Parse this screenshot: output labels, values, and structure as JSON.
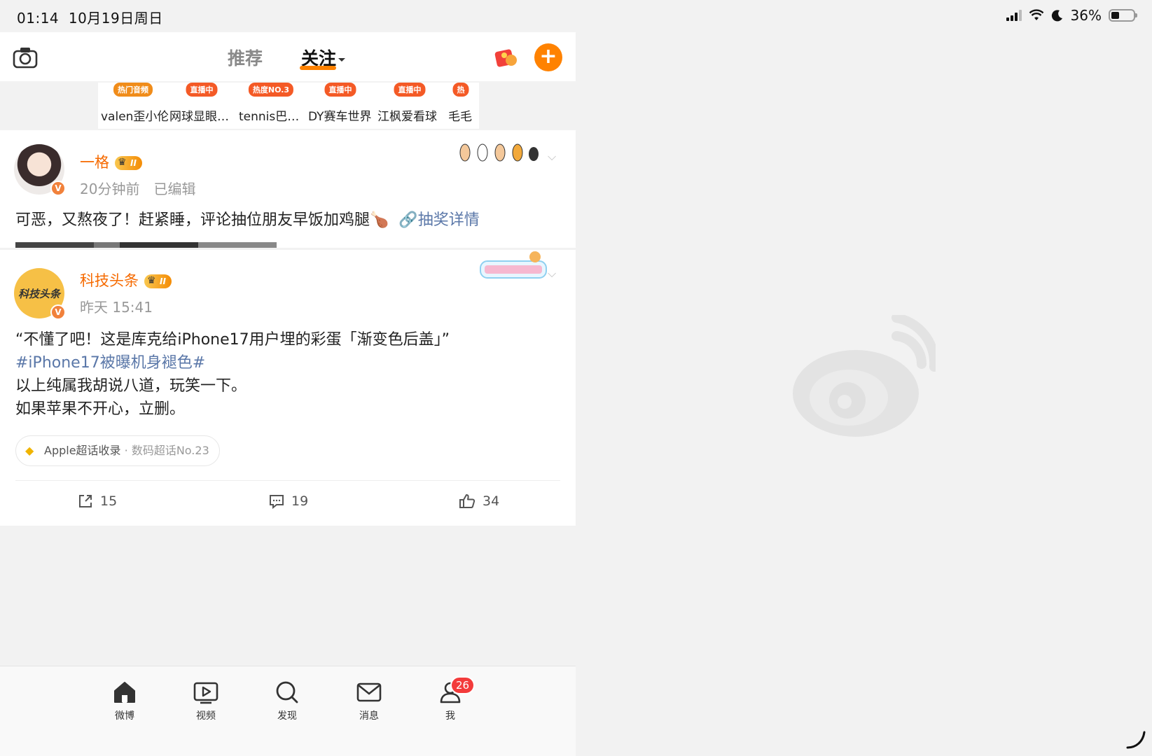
{
  "status_bar": {
    "time": "01:14",
    "date": "10月19日周日",
    "battery": "36%",
    "battery_level": 0.36
  },
  "top_nav": {
    "tab_recommend": "推荐",
    "tab_follow": "关注"
  },
  "stories": [
    {
      "badge": "热门音频",
      "name": "valen歪小伦"
    },
    {
      "badge": "直播中",
      "name": "网球显眼…"
    },
    {
      "badge": "热度NO.3",
      "name": "tennis巴…"
    },
    {
      "badge": "直播中",
      "name": "DY赛车世界"
    },
    {
      "badge": "直播中",
      "name": "江枫爱看球"
    },
    {
      "badge": "热",
      "name": "毛毛"
    }
  ],
  "post1": {
    "author": "一格",
    "level": "II",
    "time": "20分钟前",
    "edited": "已编辑",
    "text": "可恶，又熬夜了！赶紧睡，评论抽位朋友早饭加鸡腿🍗",
    "link": "🔗抽奖详情"
  },
  "post2": {
    "author": "科技头条",
    "level": "II",
    "avatar_text": "科技头条",
    "time": "昨天 15:41",
    "line1": "“不懂了吧！这是库克给iPhone17用户埋的彩蛋「渐变色后盖」”",
    "topic": "#iPhone17被曝机身褪色#",
    "line3": "以上纯属我胡说八道，玩笑一下。",
    "line4": "如果苹果不开心，立删。",
    "supertopic": "Apple超话收录",
    "supertopic_sub": " · 数码超话No.23",
    "reposts": "15",
    "comments": "19",
    "likes": "34"
  },
  "tab_bar": {
    "weibo": "微博",
    "video": "视频",
    "discover": "发现",
    "messages": "消息",
    "me": "我",
    "me_badge": "26"
  },
  "colors": {
    "accent": "#ff8200",
    "link": "#5a77a8",
    "badge_red": "#f33b3b"
  }
}
